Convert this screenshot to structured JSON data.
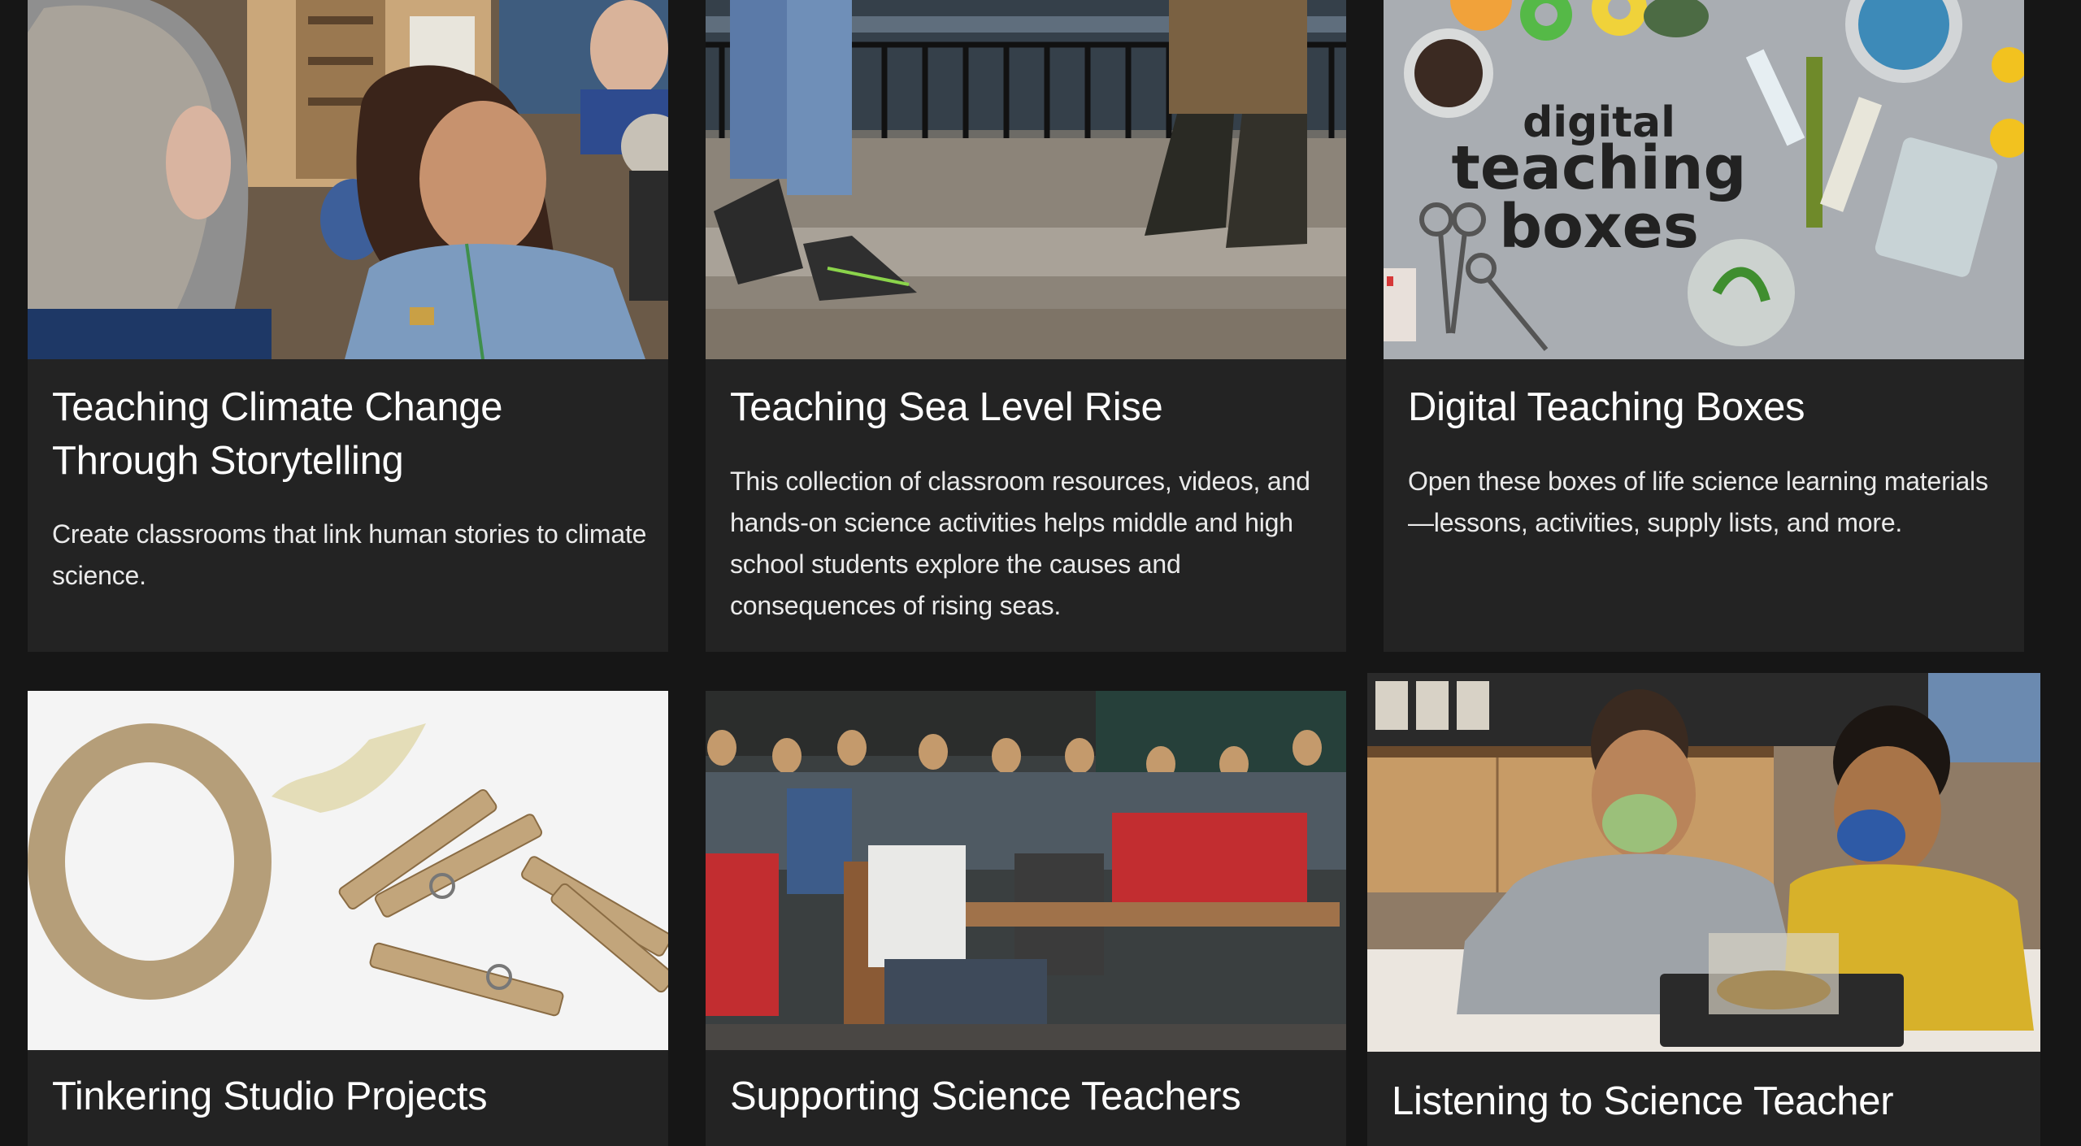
{
  "cards": [
    {
      "title": "Teaching Climate Change Through Storytelling",
      "description": "Create classrooms that link human stories to climate science.",
      "image": "people-talking-photo"
    },
    {
      "title": "Teaching Sea Level Rise",
      "description": "This collection of classroom resources, videos, and hands-on science activities helps middle and high school students explore the causes and consequences of rising seas.",
      "image": "flooded-boardwalk-photo"
    },
    {
      "title": "Digital Teaching Boxes",
      "description": "Open these boxes of life science learning materials—lessons, activities, supply lists, and more.",
      "image": "science-supplies-photo",
      "image_text": [
        "digital",
        "teaching",
        "boxes"
      ]
    },
    {
      "title": "Tinkering Studio Projects",
      "description": "",
      "image": "tape-and-clothespins-photo"
    },
    {
      "title": "Supporting Science Teachers",
      "description": "",
      "image": "teachers-workshop-photo"
    },
    {
      "title": "Listening to Science Teacher",
      "description": "",
      "image": "masked-students-experiment-photo"
    }
  ],
  "colors": {
    "page_bg": "#161616",
    "card_bg": "#232323",
    "text": "#ffffff"
  }
}
